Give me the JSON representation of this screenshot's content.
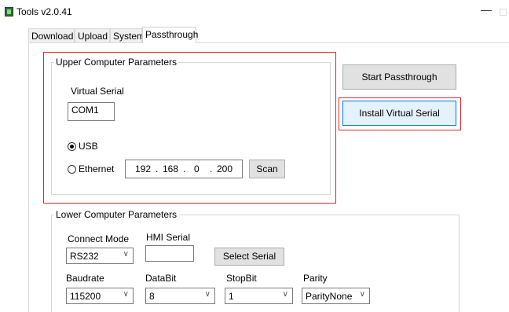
{
  "window": {
    "title": "Tools v2.0.41",
    "minimize_glyph": "—"
  },
  "tabs": [
    {
      "label": "Download",
      "active": false
    },
    {
      "label": "Upload",
      "active": false
    },
    {
      "label": "System",
      "active": false
    },
    {
      "label": "Passthrough",
      "active": true
    }
  ],
  "upper": {
    "legend": "Upper Computer Parameters",
    "virtual_serial_label": "Virtual Serial",
    "virtual_serial_value": "COM1",
    "usb_label": "USB",
    "usb_checked": true,
    "ethernet_label": "Ethernet",
    "ethernet_checked": false,
    "ip": {
      "o1": "192",
      "o2": "168",
      "o3": "0",
      "o4": "200",
      "dot": "."
    },
    "scan_label": "Scan"
  },
  "buttons": {
    "start_passthrough": "Start Passthrough",
    "install_virtual_serial": "Install Virtual Serial",
    "select_serial": "Select Serial"
  },
  "lower": {
    "legend": "Lower Computer Parameters",
    "connect_mode_label": "Connect Mode",
    "connect_mode_value": "RS232",
    "hmi_serial_label": "HMI Serial",
    "hmi_serial_value": "",
    "baudrate_label": "Baudrate",
    "baudrate_value": "115200",
    "databit_label": "DataBit",
    "databit_value": "8",
    "stopbit_label": "StopBit",
    "stopbit_value": "1",
    "parity_label": "Parity",
    "parity_value": "ParityNone"
  },
  "icons": {
    "chevron": "∨"
  },
  "colors": {
    "highlight": "#e0262b",
    "focus": "#0078d7"
  }
}
